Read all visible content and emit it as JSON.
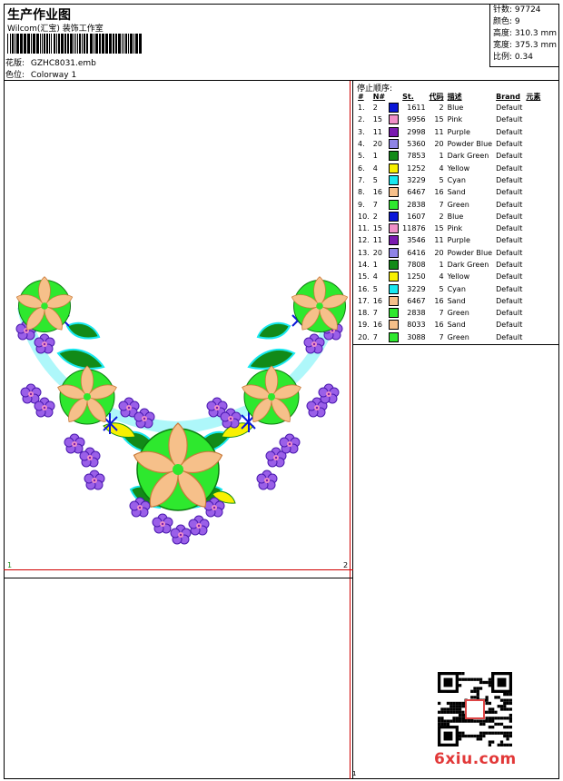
{
  "header": {
    "title": "生产作业图",
    "company": "Wilcom(汇宝) 装饰工作室",
    "design_label": "花版:",
    "design_value": "GZHC8031.emb",
    "colorway_label": "色位:",
    "colorway_value": "Colorway 1"
  },
  "stats": {
    "stitches": "针数: 97724",
    "colors": "颜色: 9",
    "height": "高度: 310.3 mm",
    "width": "宽度: 375.3 mm",
    "scale": "比例: 0.34"
  },
  "markers": {
    "left": "1",
    "right": "2",
    "bottom": "1"
  },
  "stop_sequence": {
    "title": "停止顺序:",
    "headers": [
      "#",
      "N#",
      "St.",
      "代码",
      "描述",
      "Brand",
      "元素"
    ],
    "rows": [
      {
        "n": "1.",
        "needle": "2",
        "st": "1611",
        "code": "2",
        "desc": "Blue",
        "brand": "Default",
        "color": "#0a16d8"
      },
      {
        "n": "2.",
        "needle": "15",
        "st": "9956",
        "code": "15",
        "desc": "Pink",
        "brand": "Default",
        "color": "#f08fc8"
      },
      {
        "n": "3.",
        "needle": "11",
        "st": "2998",
        "code": "11",
        "desc": "Purple",
        "brand": "Default",
        "color": "#7a1ab0"
      },
      {
        "n": "4.",
        "needle": "20",
        "st": "5360",
        "code": "20",
        "desc": "Powder Blue",
        "brand": "Default",
        "color": "#8f84e6"
      },
      {
        "n": "5.",
        "needle": "1",
        "st": "7853",
        "code": "1",
        "desc": "Dark Green",
        "brand": "Default",
        "color": "#128a18"
      },
      {
        "n": "6.",
        "needle": "4",
        "st": "1252",
        "code": "4",
        "desc": "Yellow",
        "brand": "Default",
        "color": "#f8f000"
      },
      {
        "n": "7.",
        "needle": "5",
        "st": "3229",
        "code": "5",
        "desc": "Cyan",
        "brand": "Default",
        "color": "#18e8f0"
      },
      {
        "n": "8.",
        "needle": "16",
        "st": "6467",
        "code": "16",
        "desc": "Sand",
        "brand": "Default",
        "color": "#f6c08a"
      },
      {
        "n": "9.",
        "needle": "7",
        "st": "2838",
        "code": "7",
        "desc": "Green",
        "brand": "Default",
        "color": "#2ee82e"
      },
      {
        "n": "10.",
        "needle": "2",
        "st": "1607",
        "code": "2",
        "desc": "Blue",
        "brand": "Default",
        "color": "#0a16d8"
      },
      {
        "n": "11.",
        "needle": "15",
        "st": "11876",
        "code": "15",
        "desc": "Pink",
        "brand": "Default",
        "color": "#f08fc8"
      },
      {
        "n": "12.",
        "needle": "11",
        "st": "3546",
        "code": "11",
        "desc": "Purple",
        "brand": "Default",
        "color": "#7a1ab0"
      },
      {
        "n": "13.",
        "needle": "20",
        "st": "6416",
        "code": "20",
        "desc": "Powder Blue",
        "brand": "Default",
        "color": "#8f84e6"
      },
      {
        "n": "14.",
        "needle": "1",
        "st": "7808",
        "code": "1",
        "desc": "Dark Green",
        "brand": "Default",
        "color": "#128a18"
      },
      {
        "n": "15.",
        "needle": "4",
        "st": "1250",
        "code": "4",
        "desc": "Yellow",
        "brand": "Default",
        "color": "#f8f000"
      },
      {
        "n": "16.",
        "needle": "5",
        "st": "3229",
        "code": "5",
        "desc": "Cyan",
        "brand": "Default",
        "color": "#18e8f0"
      },
      {
        "n": "17.",
        "needle": "16",
        "st": "6467",
        "code": "16",
        "desc": "Sand",
        "brand": "Default",
        "color": "#f6c08a"
      },
      {
        "n": "18.",
        "needle": "7",
        "st": "2838",
        "code": "7",
        "desc": "Green",
        "brand": "Default",
        "color": "#2ee82e"
      },
      {
        "n": "19.",
        "needle": "16",
        "st": "8033",
        "code": "16",
        "desc": "Sand",
        "brand": "Default",
        "color": "#f6c08a"
      },
      {
        "n": "20.",
        "needle": "7",
        "st": "3088",
        "code": "7",
        "desc": "Green",
        "brand": "Default",
        "color": "#2ee82e"
      }
    ]
  },
  "watermark": "6xiu.com",
  "icons": {
    "embroidery": "flower-necklace-embroidery",
    "qr": "qr-code"
  }
}
